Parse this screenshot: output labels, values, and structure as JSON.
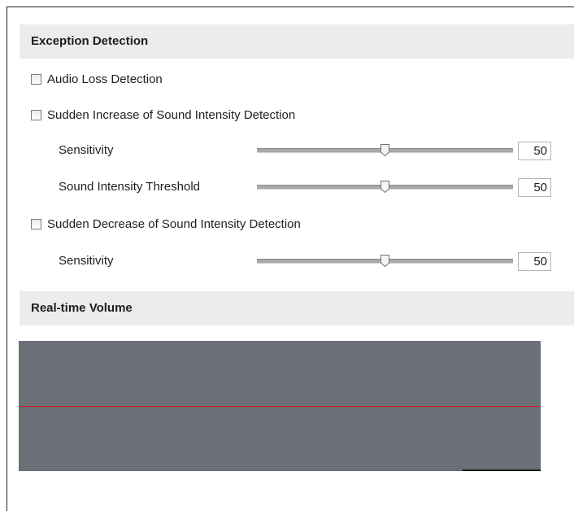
{
  "exception_section": {
    "title": "Exception Detection"
  },
  "audio_loss": {
    "label": "Audio Loss Detection",
    "checked": false
  },
  "sudden_increase": {
    "label": "Sudden Increase of Sound Intensity Detection",
    "checked": false,
    "sensitivity": {
      "label": "Sensitivity",
      "value": "50",
      "level": 50
    },
    "threshold": {
      "label": "Sound Intensity Threshold",
      "value": "50",
      "level": 50
    }
  },
  "sudden_decrease": {
    "label": "Sudden Decrease of Sound Intensity Detection",
    "checked": false,
    "sensitivity": {
      "label": "Sensitivity",
      "value": "50",
      "level": 50
    }
  },
  "volume_section": {
    "title": "Real-time Volume",
    "threshold_line_color": "#d01818",
    "panel_color": "#6a6f78"
  }
}
